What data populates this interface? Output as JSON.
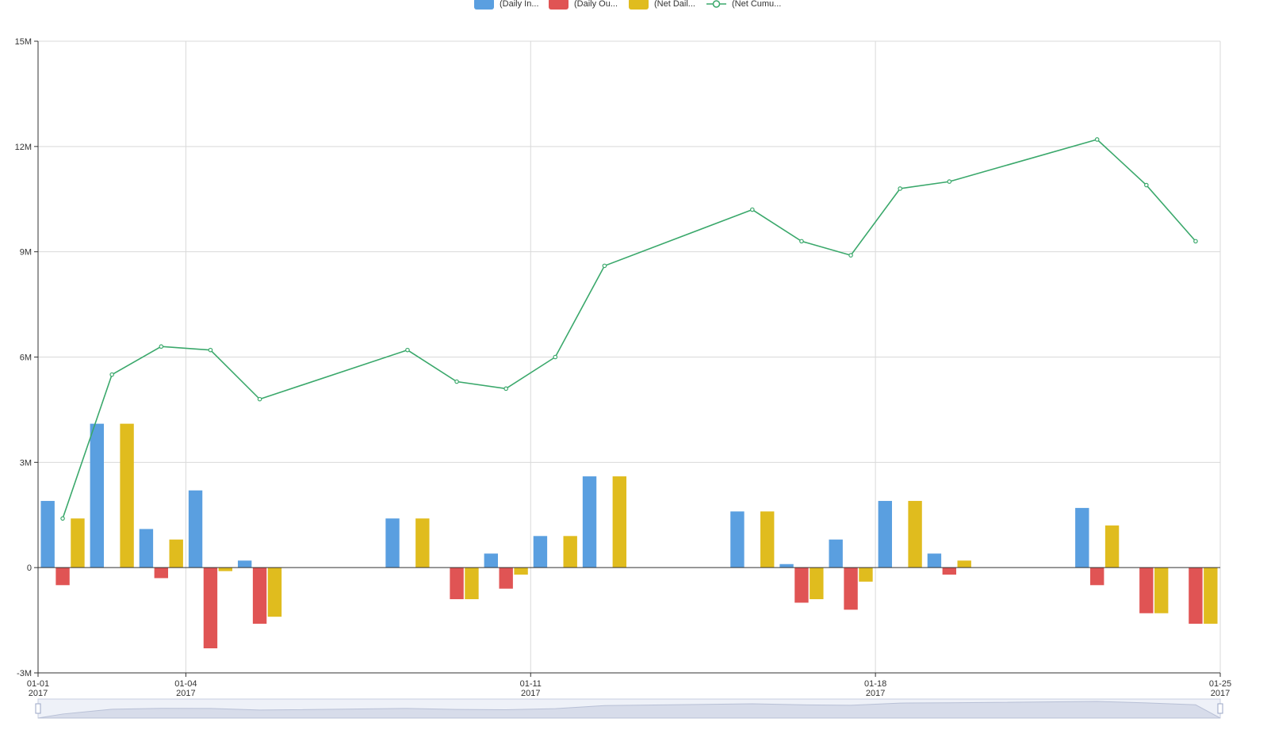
{
  "legend": [
    {
      "label": "(Daily In...",
      "color": "#5a9fe0",
      "kind": "bar"
    },
    {
      "label": "(Daily Ou...",
      "color": "#e05454",
      "kind": "bar"
    },
    {
      "label": "(Net Dail...",
      "color": "#e0bc1e",
      "kind": "bar"
    },
    {
      "label": "(Net Cumu...",
      "color": "#3aa86b",
      "kind": "line"
    }
  ],
  "chart_data": {
    "type": "bar",
    "title": "",
    "xlabel": "",
    "ylabel": "",
    "ylim": [
      -3000000,
      15000000
    ],
    "y_ticks": [
      "15M",
      "12M",
      "9M",
      "6M",
      "3M",
      "0",
      "-3M"
    ],
    "y_tick_values": [
      15000000,
      12000000,
      9000000,
      6000000,
      3000000,
      0,
      -3000000
    ],
    "x_range": [
      "2017-01-01",
      "2017-01-25"
    ],
    "x_ticks": [
      {
        "date": "2017-01-01",
        "label": "01-01",
        "year": "2017"
      },
      {
        "date": "2017-01-04",
        "label": "01-04",
        "year": "2017"
      },
      {
        "date": "2017-01-11",
        "label": "01-11",
        "year": "2017"
      },
      {
        "date": "2017-01-18",
        "label": "01-18",
        "year": "2017"
      },
      {
        "date": "2017-01-25",
        "label": "01-25",
        "year": "2017"
      }
    ],
    "grid": true,
    "legend_position": "top",
    "dates": [
      "2017-01-02",
      "2017-01-03",
      "2017-01-04",
      "2017-01-05",
      "2017-01-06",
      "2017-01-07",
      "2017-01-08",
      "2017-01-09",
      "2017-01-10",
      "2017-01-11",
      "2017-01-12",
      "2017-01-13",
      "2017-01-14",
      "2017-01-15",
      "2017-01-16",
      "2017-01-17",
      "2017-01-18",
      "2017-01-19",
      "2017-01-20",
      "2017-01-21",
      "2017-01-22",
      "2017-01-23",
      "2017-01-24",
      "2017-01-25"
    ],
    "series": [
      {
        "name": "(Daily In...",
        "type": "bar",
        "color": "#5a9fe0",
        "values": [
          1900000,
          4100000,
          1100000,
          2200000,
          200000,
          0,
          0,
          1400000,
          0,
          400000,
          900000,
          2600000,
          0,
          0,
          1600000,
          100000,
          800000,
          1900000,
          400000,
          0,
          0,
          1700000,
          0,
          0
        ]
      },
      {
        "name": "(Daily Ou...",
        "type": "bar",
        "color": "#e05454",
        "values": [
          -500000,
          0,
          -300000,
          -2300000,
          -1600000,
          0,
          0,
          0,
          -900000,
          -600000,
          0,
          0,
          0,
          0,
          0,
          -1000000,
          -1200000,
          0,
          -200000,
          0,
          0,
          -500000,
          -1300000,
          -1600000
        ]
      },
      {
        "name": "(Net Dail...",
        "type": "bar",
        "color": "#e0bc1e",
        "values": [
          1400000,
          4100000,
          800000,
          -100000,
          -1400000,
          0,
          0,
          1400000,
          -900000,
          -200000,
          900000,
          2600000,
          0,
          0,
          1600000,
          -900000,
          -400000,
          1900000,
          200000,
          0,
          0,
          1200000,
          -1300000,
          -1600000
        ]
      },
      {
        "name": "(Net Cumu...",
        "type": "line",
        "color": "#3aa86b",
        "values": [
          1400000,
          5500000,
          6300000,
          6200000,
          4800000,
          null,
          null,
          6200000,
          5300000,
          5100000,
          6000000,
          8600000,
          null,
          null,
          10200000,
          9300000,
          8900000,
          10800000,
          11000000,
          null,
          null,
          12200000,
          10900000,
          9300000
        ]
      }
    ]
  }
}
